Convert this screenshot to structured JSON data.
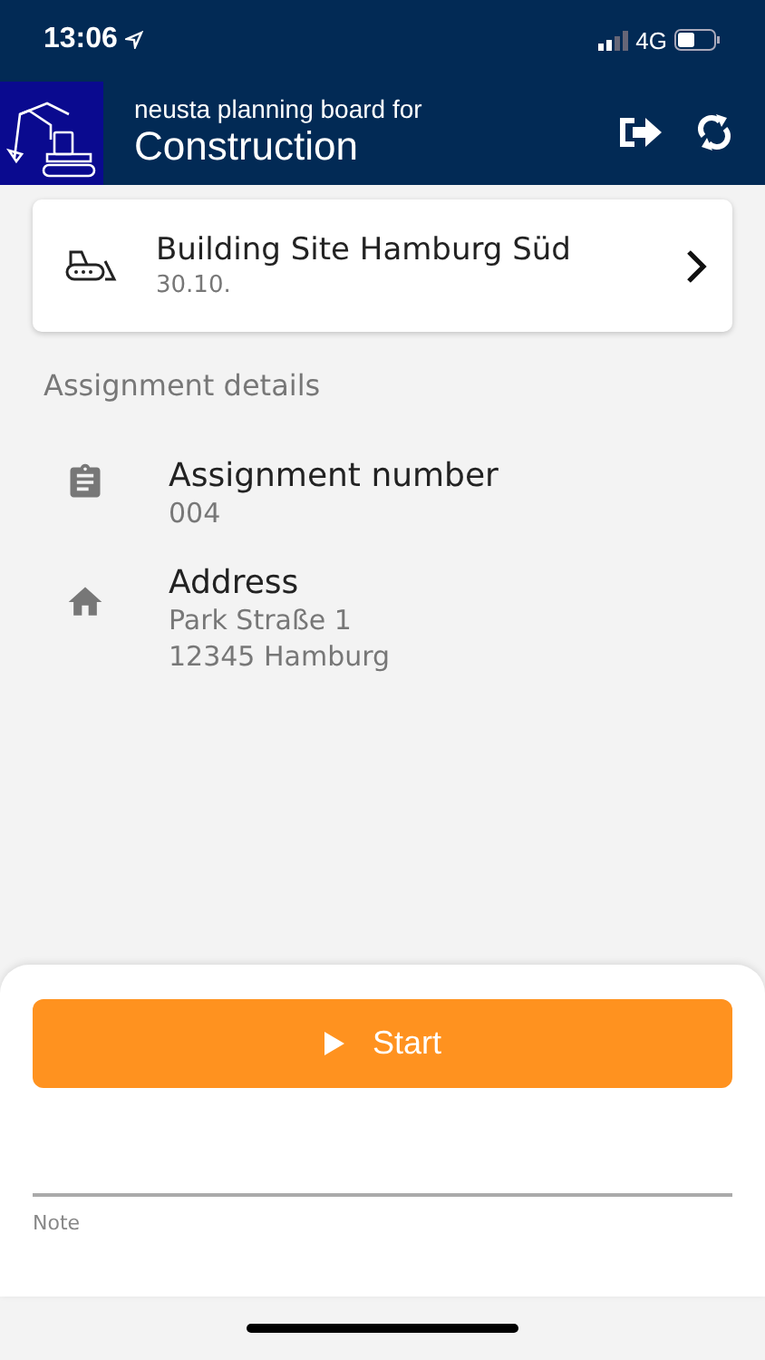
{
  "status_bar": {
    "time": "13:06",
    "network": "4G"
  },
  "header": {
    "subtitle": "neusta planning board for",
    "title": "Construction"
  },
  "site_card": {
    "name": "Building Site Hamburg Süd",
    "date": "30.10."
  },
  "section_title": "Assignment details",
  "details": [
    {
      "kind": "clipboard",
      "label": "Assignment number",
      "lines": [
        "004"
      ]
    },
    {
      "kind": "home",
      "label": "Address",
      "lines": [
        "Park Straße 1",
        "12345 Hamburg"
      ]
    }
  ],
  "start_button": {
    "label": "Start"
  },
  "note_field": {
    "label": "Note"
  }
}
